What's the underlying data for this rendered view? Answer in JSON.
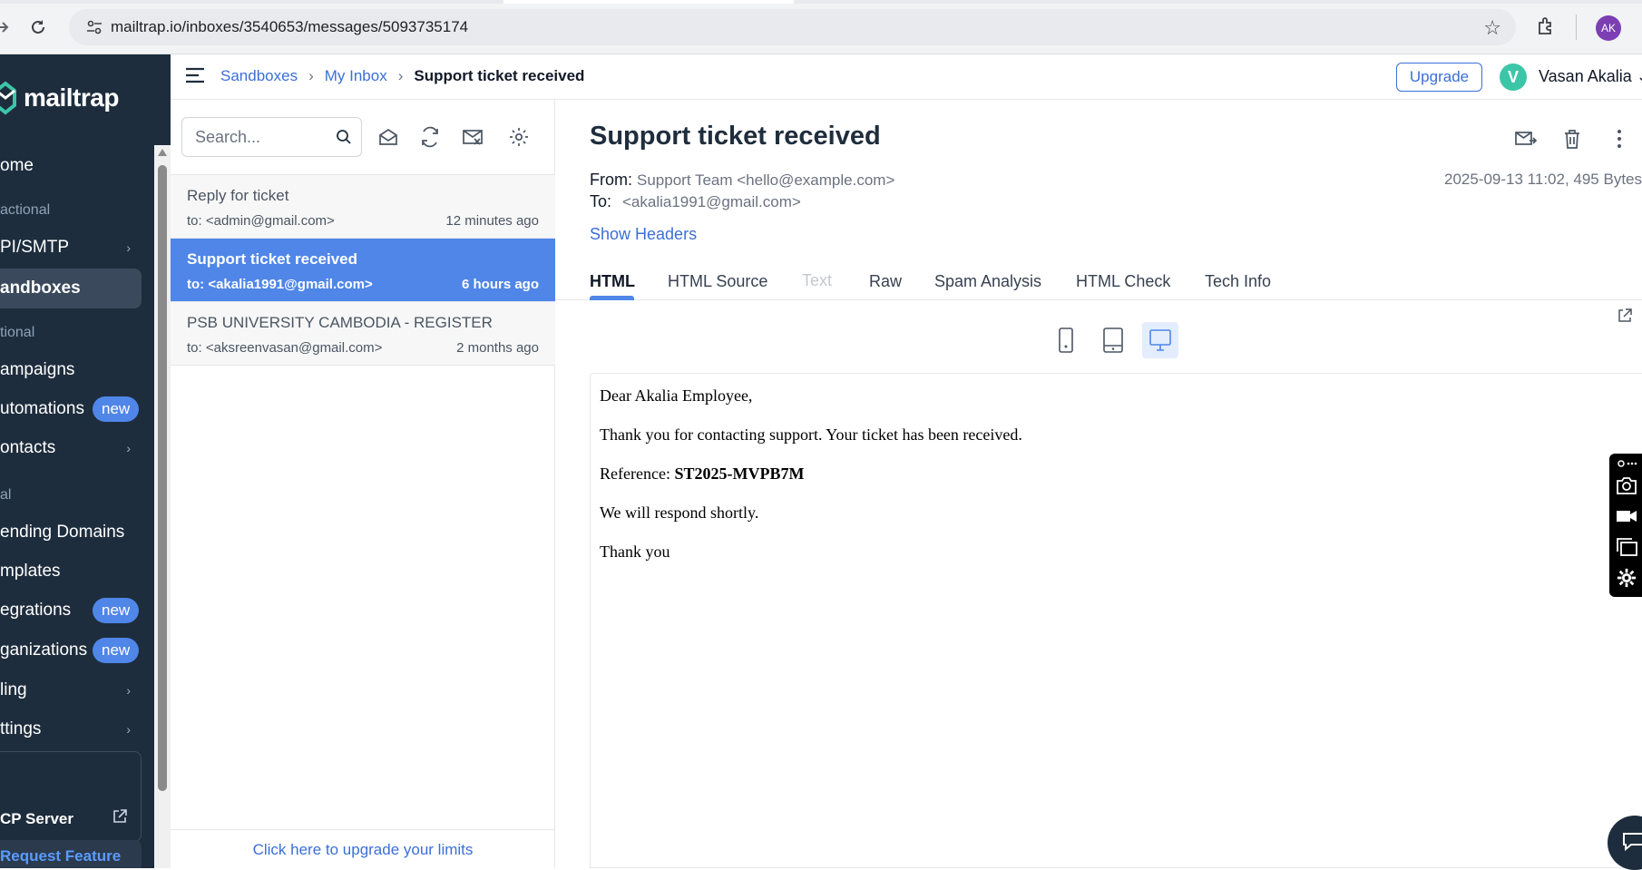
{
  "browser": {
    "url": "mailtrap.io/inboxes/3540653/messages/5093735174",
    "profile_initials": "AK"
  },
  "sidebar": {
    "logo_text": "mailtrap",
    "items": [
      {
        "label": "ome",
        "active": false
      },
      {
        "label": "PI/SMTP",
        "active": false
      },
      {
        "label": "andboxes",
        "active": true
      },
      {
        "label": "ampaigns",
        "active": false
      },
      {
        "label": "utomations",
        "badge": "new"
      },
      {
        "label": "ontacts",
        "active": false
      },
      {
        "label": "ending Domains",
        "active": false
      },
      {
        "label": "mplates",
        "active": false
      },
      {
        "label": "egrations",
        "badge": "new"
      },
      {
        "label": "ganizations",
        "badge": "new"
      },
      {
        "label": "ling",
        "active": false
      },
      {
        "label": "ttings",
        "active": false
      }
    ],
    "sections": [
      "actional",
      "tional",
      "al"
    ],
    "mcp_label": "CP Server",
    "request_feature": "Request Feature"
  },
  "topbar": {
    "breadcrumb": [
      "Sandboxes",
      "My Inbox",
      "Support ticket received"
    ],
    "upgrade_label": "Upgrade",
    "user_initial": "V",
    "user_name": "Vasan Akalia"
  },
  "list": {
    "search_placeholder": "Search...",
    "messages": [
      {
        "subject": "Reply for ticket",
        "to": "to: <admin@gmail.com>",
        "time": "12 minutes ago",
        "selected": false
      },
      {
        "subject": "Support ticket received",
        "to": "to: <akalia1991@gmail.com>",
        "time": "6 hours ago",
        "selected": true
      },
      {
        "subject": "PSB UNIVERSITY CAMBODIA - REGISTER",
        "to": "to: <aksreenvasan@gmail.com>",
        "time": "2 months ago",
        "selected": false
      }
    ],
    "footer_link": "Click here to upgrade your limits"
  },
  "message": {
    "title": "Support ticket received",
    "from_label": "From:",
    "from_value": "Support Team <hello@example.com>",
    "to_label": "To:",
    "to_value": "<akalia1991@gmail.com>",
    "date_size": "2025-09-13 11:02, 495 Bytes",
    "show_headers": "Show Headers",
    "tabs": [
      "HTML",
      "HTML Source",
      "Text",
      "Raw",
      "Spam Analysis",
      "HTML Check",
      "Tech Info"
    ],
    "active_tab": "HTML",
    "disabled_tab": "Text",
    "active_device": "desktop",
    "body": {
      "greeting": "Dear Akalia Employee,",
      "line1": "Thank you for contacting support. Your ticket has been received.",
      "ref_label": "Reference: ",
      "ref_value": "ST2025-MVPB7M",
      "line2": "We will respond shortly.",
      "closing": "Thank you"
    }
  },
  "colors": {
    "sidebar_bg": "#1e2d3d",
    "accent": "#4f86e8",
    "link": "#3b6fd8"
  }
}
